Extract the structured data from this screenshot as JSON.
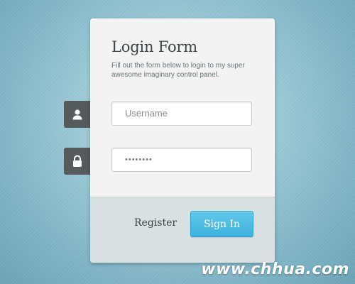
{
  "login": {
    "title": "Login Form",
    "subtitle": "Fill out the form below to login to my super awesome imaginary control panel.",
    "username_placeholder": "Username",
    "password_value": "••••••••",
    "register_label": "Register",
    "signin_label": "Sign In"
  },
  "icons": {
    "user": "user-icon",
    "lock": "lock-icon"
  },
  "watermark": "www.chhua.com",
  "colors": {
    "accent": "#4dbbe2",
    "icon_tab": "#555a5d",
    "card": "#f3f3f3",
    "footer": "#d9e0e2"
  }
}
